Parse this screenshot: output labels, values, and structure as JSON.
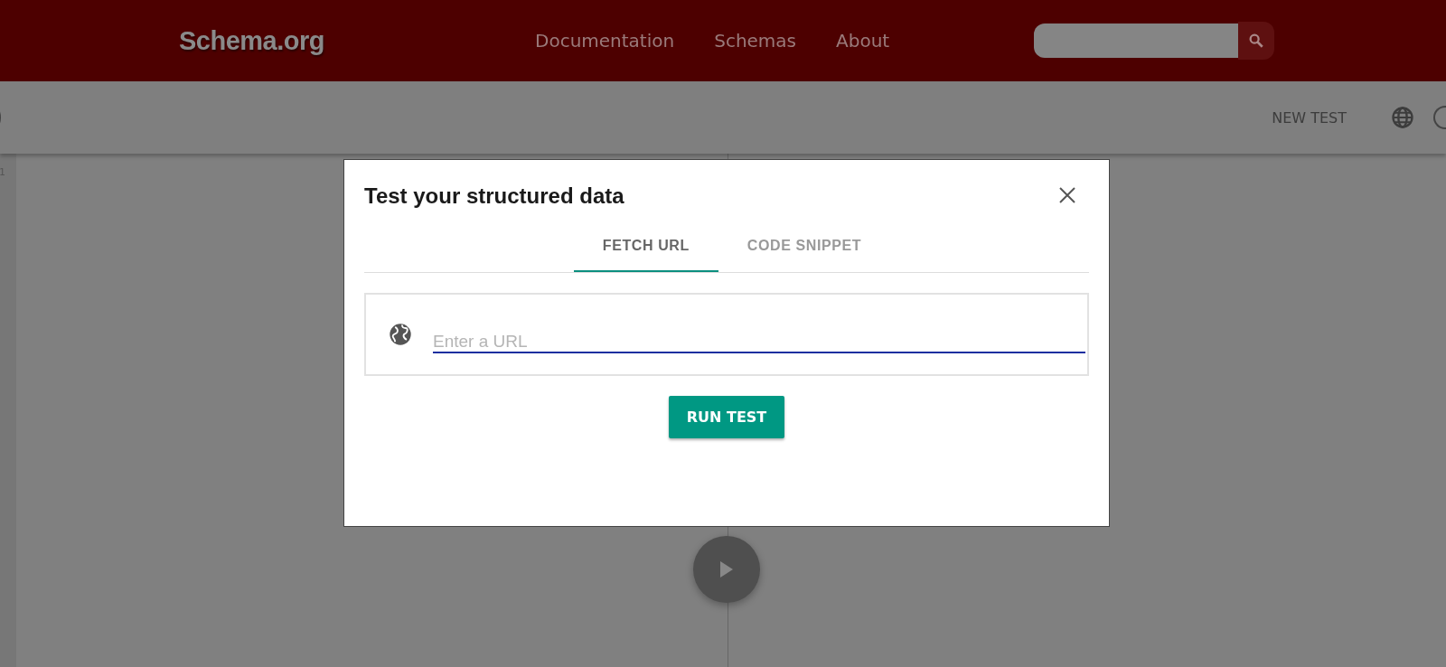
{
  "header": {
    "logo": "Schema.org",
    "nav": [
      {
        "label": "Documentation"
      },
      {
        "label": "Schemas"
      },
      {
        "label": "About"
      }
    ]
  },
  "toolbar": {
    "new_test": "NEW TEST"
  },
  "editor": {
    "line_numbers": [
      "1"
    ]
  },
  "dialog": {
    "title": "Test your structured data",
    "tabs": [
      {
        "label": "FETCH URL",
        "selected": true
      },
      {
        "label": "CODE SNIPPET",
        "selected": false
      }
    ],
    "url_field": {
      "placeholder": "Enter a URL"
    },
    "run_button": "RUN TEST"
  }
}
